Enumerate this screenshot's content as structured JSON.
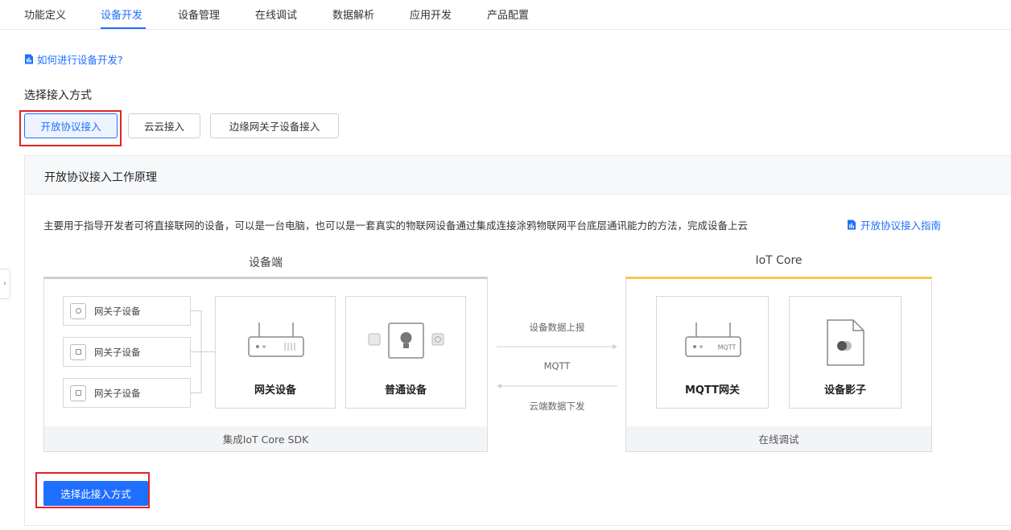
{
  "tabs": [
    {
      "label": "功能定义"
    },
    {
      "label": "设备开发",
      "active": true
    },
    {
      "label": "设备管理"
    },
    {
      "label": "在线调试"
    },
    {
      "label": "数据解析"
    },
    {
      "label": "应用开发"
    },
    {
      "label": "产品配置"
    }
  ],
  "help_link": "如何进行设备开发?",
  "access": {
    "label": "选择接入方式",
    "options": [
      "开放协议接入",
      "云云接入",
      "边缘网关子设备接入"
    ],
    "selected": "开放协议接入"
  },
  "panel": {
    "title": "开放协议接入工作原理",
    "description": "主要用于指导开发者可将直接联网的设备，可以是一台电脑，也可以是一套真实的物联网设备通过集成连接涂鸦物联网平台底层通讯能力的方法，完成设备上云",
    "guide_link": "开放协议接入指南"
  },
  "diagram": {
    "device_side": {
      "title": "设备端",
      "sub_devices": [
        "网关子设备",
        "网关子设备",
        "网关子设备"
      ],
      "gateway": "网关设备",
      "normal": "普通设备",
      "footer": "集成IoT Core SDK"
    },
    "arrows": {
      "up": "设备数据上报",
      "protocol": "MQTT",
      "down": "云端数据下发"
    },
    "cloud_side": {
      "title": "IoT Core",
      "mqtt_gateway": "MQTT网关",
      "mqtt_tag": "MQTT",
      "shadow": "设备影子",
      "footer": "在线调试"
    }
  },
  "action_button": "选择此接入方式",
  "colors": {
    "primary": "#1f6fff",
    "highlight": "#e02424",
    "iot_accent": "#f5c84c"
  }
}
